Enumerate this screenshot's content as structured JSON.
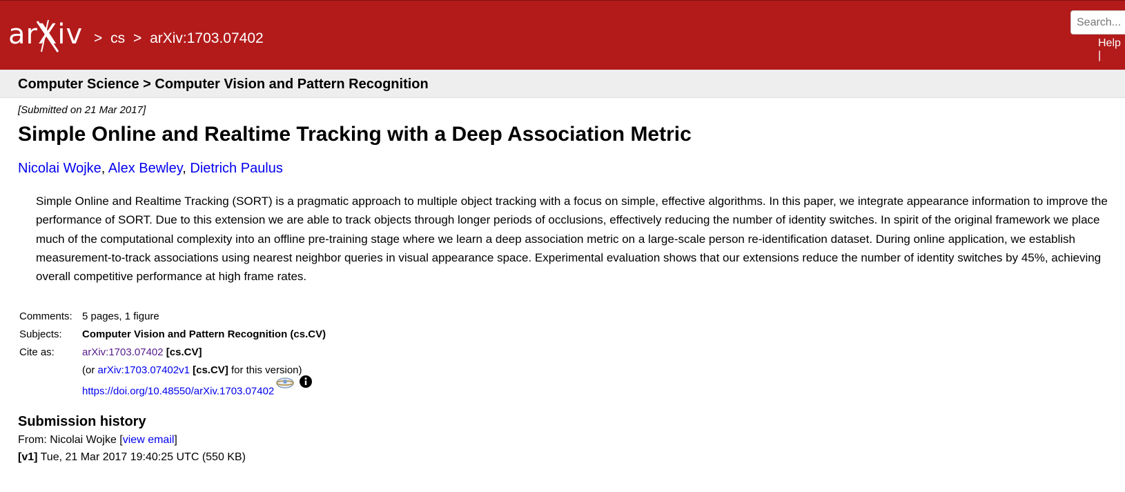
{
  "header": {
    "logo_text": "arXiv",
    "breadcrumb": [
      ">",
      "cs",
      ">",
      "arXiv:1703.07402"
    ],
    "search_placeholder": "Search...",
    "help_label": "Help |"
  },
  "category_bar": "Computer Science > Computer Vision and Pattern Recognition",
  "paper": {
    "submitted": "[Submitted on 21 Mar 2017]",
    "title": "Simple Online and Realtime Tracking with a Deep Association Metric",
    "authors": [
      "Nicolai Wojke",
      "Alex Bewley",
      "Dietrich Paulus"
    ],
    "author_sep": ", ",
    "abstract": "Simple Online and Realtime Tracking (SORT) is a pragmatic approach to multiple object tracking with a focus on simple, effective algorithms. In this paper, we integrate appearance information to improve the performance of SORT. Due to this extension we are able to track objects through longer periods of occlusions, effectively reducing the number of identity switches. In spirit of the original framework we place much of the computational complexity into an offline pre-training stage where we learn a deep association metric on a large-scale person re-identification dataset. During online application, we establish measurement-to-track associations using nearest neighbor queries in visual appearance space. Experimental evaluation shows that our extensions reduce the number of identity switches by 45%, achieving overall competitive performance at high frame rates."
  },
  "meta": {
    "comments_label": "Comments:",
    "comments_value": "5 pages, 1 figure",
    "subjects_label": "Subjects:",
    "subjects_value": "Computer Vision and Pattern Recognition (cs.CV)",
    "cite_label": "Cite as:",
    "cite_id": "arXiv:1703.07402",
    "cite_cat": "[cs.CV]",
    "or_prefix": "(or ",
    "cite_version_id": "arXiv:1703.07402v1",
    "cite_version_cat": "[cs.CV]",
    "for_version": " for this version)",
    "doi": "https://doi.org/10.48550/arXiv.1703.07402",
    "icons": [
      "datacite-icon",
      "info-icon"
    ]
  },
  "history": {
    "heading": "Submission history",
    "from_prefix": "From: Nicolai Wojke [",
    "view_email": "view email",
    "from_suffix": "]",
    "v1_label": "[v1]",
    "v1_text": " Tue, 21 Mar 2017 19:40:25 UTC (550 KB)"
  },
  "colors": {
    "header_red": "#b31b1b",
    "link_blue": "#0000ee",
    "visited_purple": "#551a8b",
    "category_bar_bg": "#eeeeee"
  }
}
